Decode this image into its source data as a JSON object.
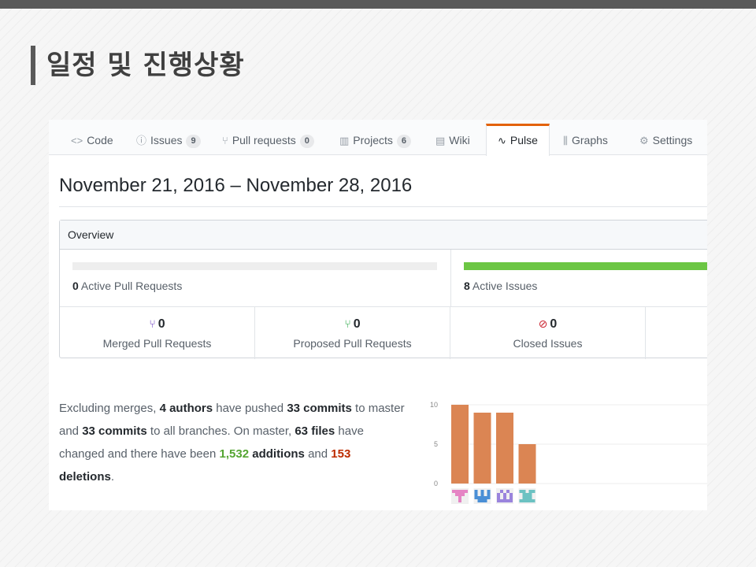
{
  "slide": {
    "title": "일정 및 진행상황"
  },
  "tabs": [
    {
      "icon": "code-icon",
      "glyph": "<>",
      "label": "Code",
      "count": null
    },
    {
      "icon": "issue-icon",
      "glyph": "ⓘ",
      "label": "Issues",
      "count": "9"
    },
    {
      "icon": "pull-request-icon",
      "glyph": "⑂",
      "label": "Pull requests",
      "count": "0"
    },
    {
      "icon": "project-icon",
      "glyph": "▥",
      "label": "Projects",
      "count": "6"
    },
    {
      "icon": "wiki-icon",
      "glyph": "▤",
      "label": "Wiki",
      "count": null
    },
    {
      "icon": "pulse-icon",
      "glyph": "∿",
      "label": "Pulse",
      "count": null,
      "selected": true
    },
    {
      "icon": "graph-icon",
      "glyph": "⫼",
      "label": "Graphs",
      "count": null
    },
    {
      "icon": "gear-icon",
      "glyph": "⚙",
      "label": "Settings",
      "count": null
    }
  ],
  "pulse": {
    "date_range": "November 21, 2016 – November 28, 2016",
    "overview": {
      "header": "Overview",
      "active_pull_requests": {
        "count": "0",
        "label": "Active Pull Requests",
        "fill_fraction": 0
      },
      "active_issues": {
        "count": "8",
        "label": "Active Issues",
        "fill_fraction": 1
      },
      "stats": [
        {
          "icon": "merged-pr-icon",
          "glyph": "⑂",
          "color": "#6f42c1",
          "count": "0",
          "label": "Merged Pull Requests"
        },
        {
          "icon": "proposed-pr-icon",
          "glyph": "⑂",
          "color": "#28a745",
          "count": "0",
          "label": "Proposed Pull Requests"
        },
        {
          "icon": "closed-issue-icon",
          "glyph": "⊘",
          "color": "#cb2431",
          "count": "0",
          "label": "Closed Issues"
        }
      ]
    },
    "summary": {
      "p1": "Excluding merges, ",
      "authors": "4 authors",
      "p2": " have pushed ",
      "commits": "33 commits",
      "p3": " to master and ",
      "commits_all": "33 commits",
      "p4": " to all branches. On master, ",
      "files": "63 files",
      "p5": " have changed and there have been ",
      "additions_num": "1,532",
      "additions_word": " additions",
      "p6": " and ",
      "deletions_num": "153",
      "deletions_word": " deletions",
      "p7": "."
    }
  },
  "chart_data": {
    "type": "bar",
    "categories": [
      "author-1",
      "author-2",
      "author-3",
      "author-4"
    ],
    "values": [
      10,
      9,
      9,
      5
    ],
    "ylim": [
      0,
      10
    ],
    "yticks": [
      0,
      5,
      10
    ],
    "bar_color": "#db8553",
    "grid": true,
    "avatar_colors": [
      "#e584c4",
      "#4a8fd6",
      "#9a84dd",
      "#6cc2c2"
    ]
  }
}
